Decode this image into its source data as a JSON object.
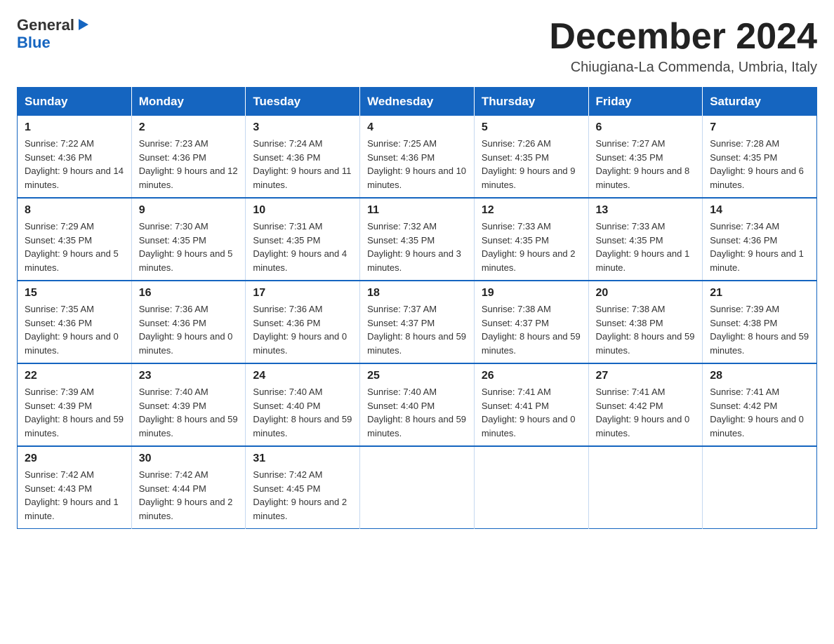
{
  "logo": {
    "line1": "General",
    "arrow": "▶",
    "line2": "Blue"
  },
  "title": "December 2024",
  "location": "Chiugiana-La Commenda, Umbria, Italy",
  "days_of_week": [
    "Sunday",
    "Monday",
    "Tuesday",
    "Wednesday",
    "Thursday",
    "Friday",
    "Saturday"
  ],
  "weeks": [
    [
      {
        "day": "1",
        "sunrise": "7:22 AM",
        "sunset": "4:36 PM",
        "daylight": "9 hours and 14 minutes."
      },
      {
        "day": "2",
        "sunrise": "7:23 AM",
        "sunset": "4:36 PM",
        "daylight": "9 hours and 12 minutes."
      },
      {
        "day": "3",
        "sunrise": "7:24 AM",
        "sunset": "4:36 PM",
        "daylight": "9 hours and 11 minutes."
      },
      {
        "day": "4",
        "sunrise": "7:25 AM",
        "sunset": "4:36 PM",
        "daylight": "9 hours and 10 minutes."
      },
      {
        "day": "5",
        "sunrise": "7:26 AM",
        "sunset": "4:35 PM",
        "daylight": "9 hours and 9 minutes."
      },
      {
        "day": "6",
        "sunrise": "7:27 AM",
        "sunset": "4:35 PM",
        "daylight": "9 hours and 8 minutes."
      },
      {
        "day": "7",
        "sunrise": "7:28 AM",
        "sunset": "4:35 PM",
        "daylight": "9 hours and 6 minutes."
      }
    ],
    [
      {
        "day": "8",
        "sunrise": "7:29 AM",
        "sunset": "4:35 PM",
        "daylight": "9 hours and 5 minutes."
      },
      {
        "day": "9",
        "sunrise": "7:30 AM",
        "sunset": "4:35 PM",
        "daylight": "9 hours and 5 minutes."
      },
      {
        "day": "10",
        "sunrise": "7:31 AM",
        "sunset": "4:35 PM",
        "daylight": "9 hours and 4 minutes."
      },
      {
        "day": "11",
        "sunrise": "7:32 AM",
        "sunset": "4:35 PM",
        "daylight": "9 hours and 3 minutes."
      },
      {
        "day": "12",
        "sunrise": "7:33 AM",
        "sunset": "4:35 PM",
        "daylight": "9 hours and 2 minutes."
      },
      {
        "day": "13",
        "sunrise": "7:33 AM",
        "sunset": "4:35 PM",
        "daylight": "9 hours and 1 minute."
      },
      {
        "day": "14",
        "sunrise": "7:34 AM",
        "sunset": "4:36 PM",
        "daylight": "9 hours and 1 minute."
      }
    ],
    [
      {
        "day": "15",
        "sunrise": "7:35 AM",
        "sunset": "4:36 PM",
        "daylight": "9 hours and 0 minutes."
      },
      {
        "day": "16",
        "sunrise": "7:36 AM",
        "sunset": "4:36 PM",
        "daylight": "9 hours and 0 minutes."
      },
      {
        "day": "17",
        "sunrise": "7:36 AM",
        "sunset": "4:36 PM",
        "daylight": "9 hours and 0 minutes."
      },
      {
        "day": "18",
        "sunrise": "7:37 AM",
        "sunset": "4:37 PM",
        "daylight": "8 hours and 59 minutes."
      },
      {
        "day": "19",
        "sunrise": "7:38 AM",
        "sunset": "4:37 PM",
        "daylight": "8 hours and 59 minutes."
      },
      {
        "day": "20",
        "sunrise": "7:38 AM",
        "sunset": "4:38 PM",
        "daylight": "8 hours and 59 minutes."
      },
      {
        "day": "21",
        "sunrise": "7:39 AM",
        "sunset": "4:38 PM",
        "daylight": "8 hours and 59 minutes."
      }
    ],
    [
      {
        "day": "22",
        "sunrise": "7:39 AM",
        "sunset": "4:39 PM",
        "daylight": "8 hours and 59 minutes."
      },
      {
        "day": "23",
        "sunrise": "7:40 AM",
        "sunset": "4:39 PM",
        "daylight": "8 hours and 59 minutes."
      },
      {
        "day": "24",
        "sunrise": "7:40 AM",
        "sunset": "4:40 PM",
        "daylight": "8 hours and 59 minutes."
      },
      {
        "day": "25",
        "sunrise": "7:40 AM",
        "sunset": "4:40 PM",
        "daylight": "8 hours and 59 minutes."
      },
      {
        "day": "26",
        "sunrise": "7:41 AM",
        "sunset": "4:41 PM",
        "daylight": "9 hours and 0 minutes."
      },
      {
        "day": "27",
        "sunrise": "7:41 AM",
        "sunset": "4:42 PM",
        "daylight": "9 hours and 0 minutes."
      },
      {
        "day": "28",
        "sunrise": "7:41 AM",
        "sunset": "4:42 PM",
        "daylight": "9 hours and 0 minutes."
      }
    ],
    [
      {
        "day": "29",
        "sunrise": "7:42 AM",
        "sunset": "4:43 PM",
        "daylight": "9 hours and 1 minute."
      },
      {
        "day": "30",
        "sunrise": "7:42 AM",
        "sunset": "4:44 PM",
        "daylight": "9 hours and 2 minutes."
      },
      {
        "day": "31",
        "sunrise": "7:42 AM",
        "sunset": "4:45 PM",
        "daylight": "9 hours and 2 minutes."
      },
      null,
      null,
      null,
      null
    ]
  ]
}
